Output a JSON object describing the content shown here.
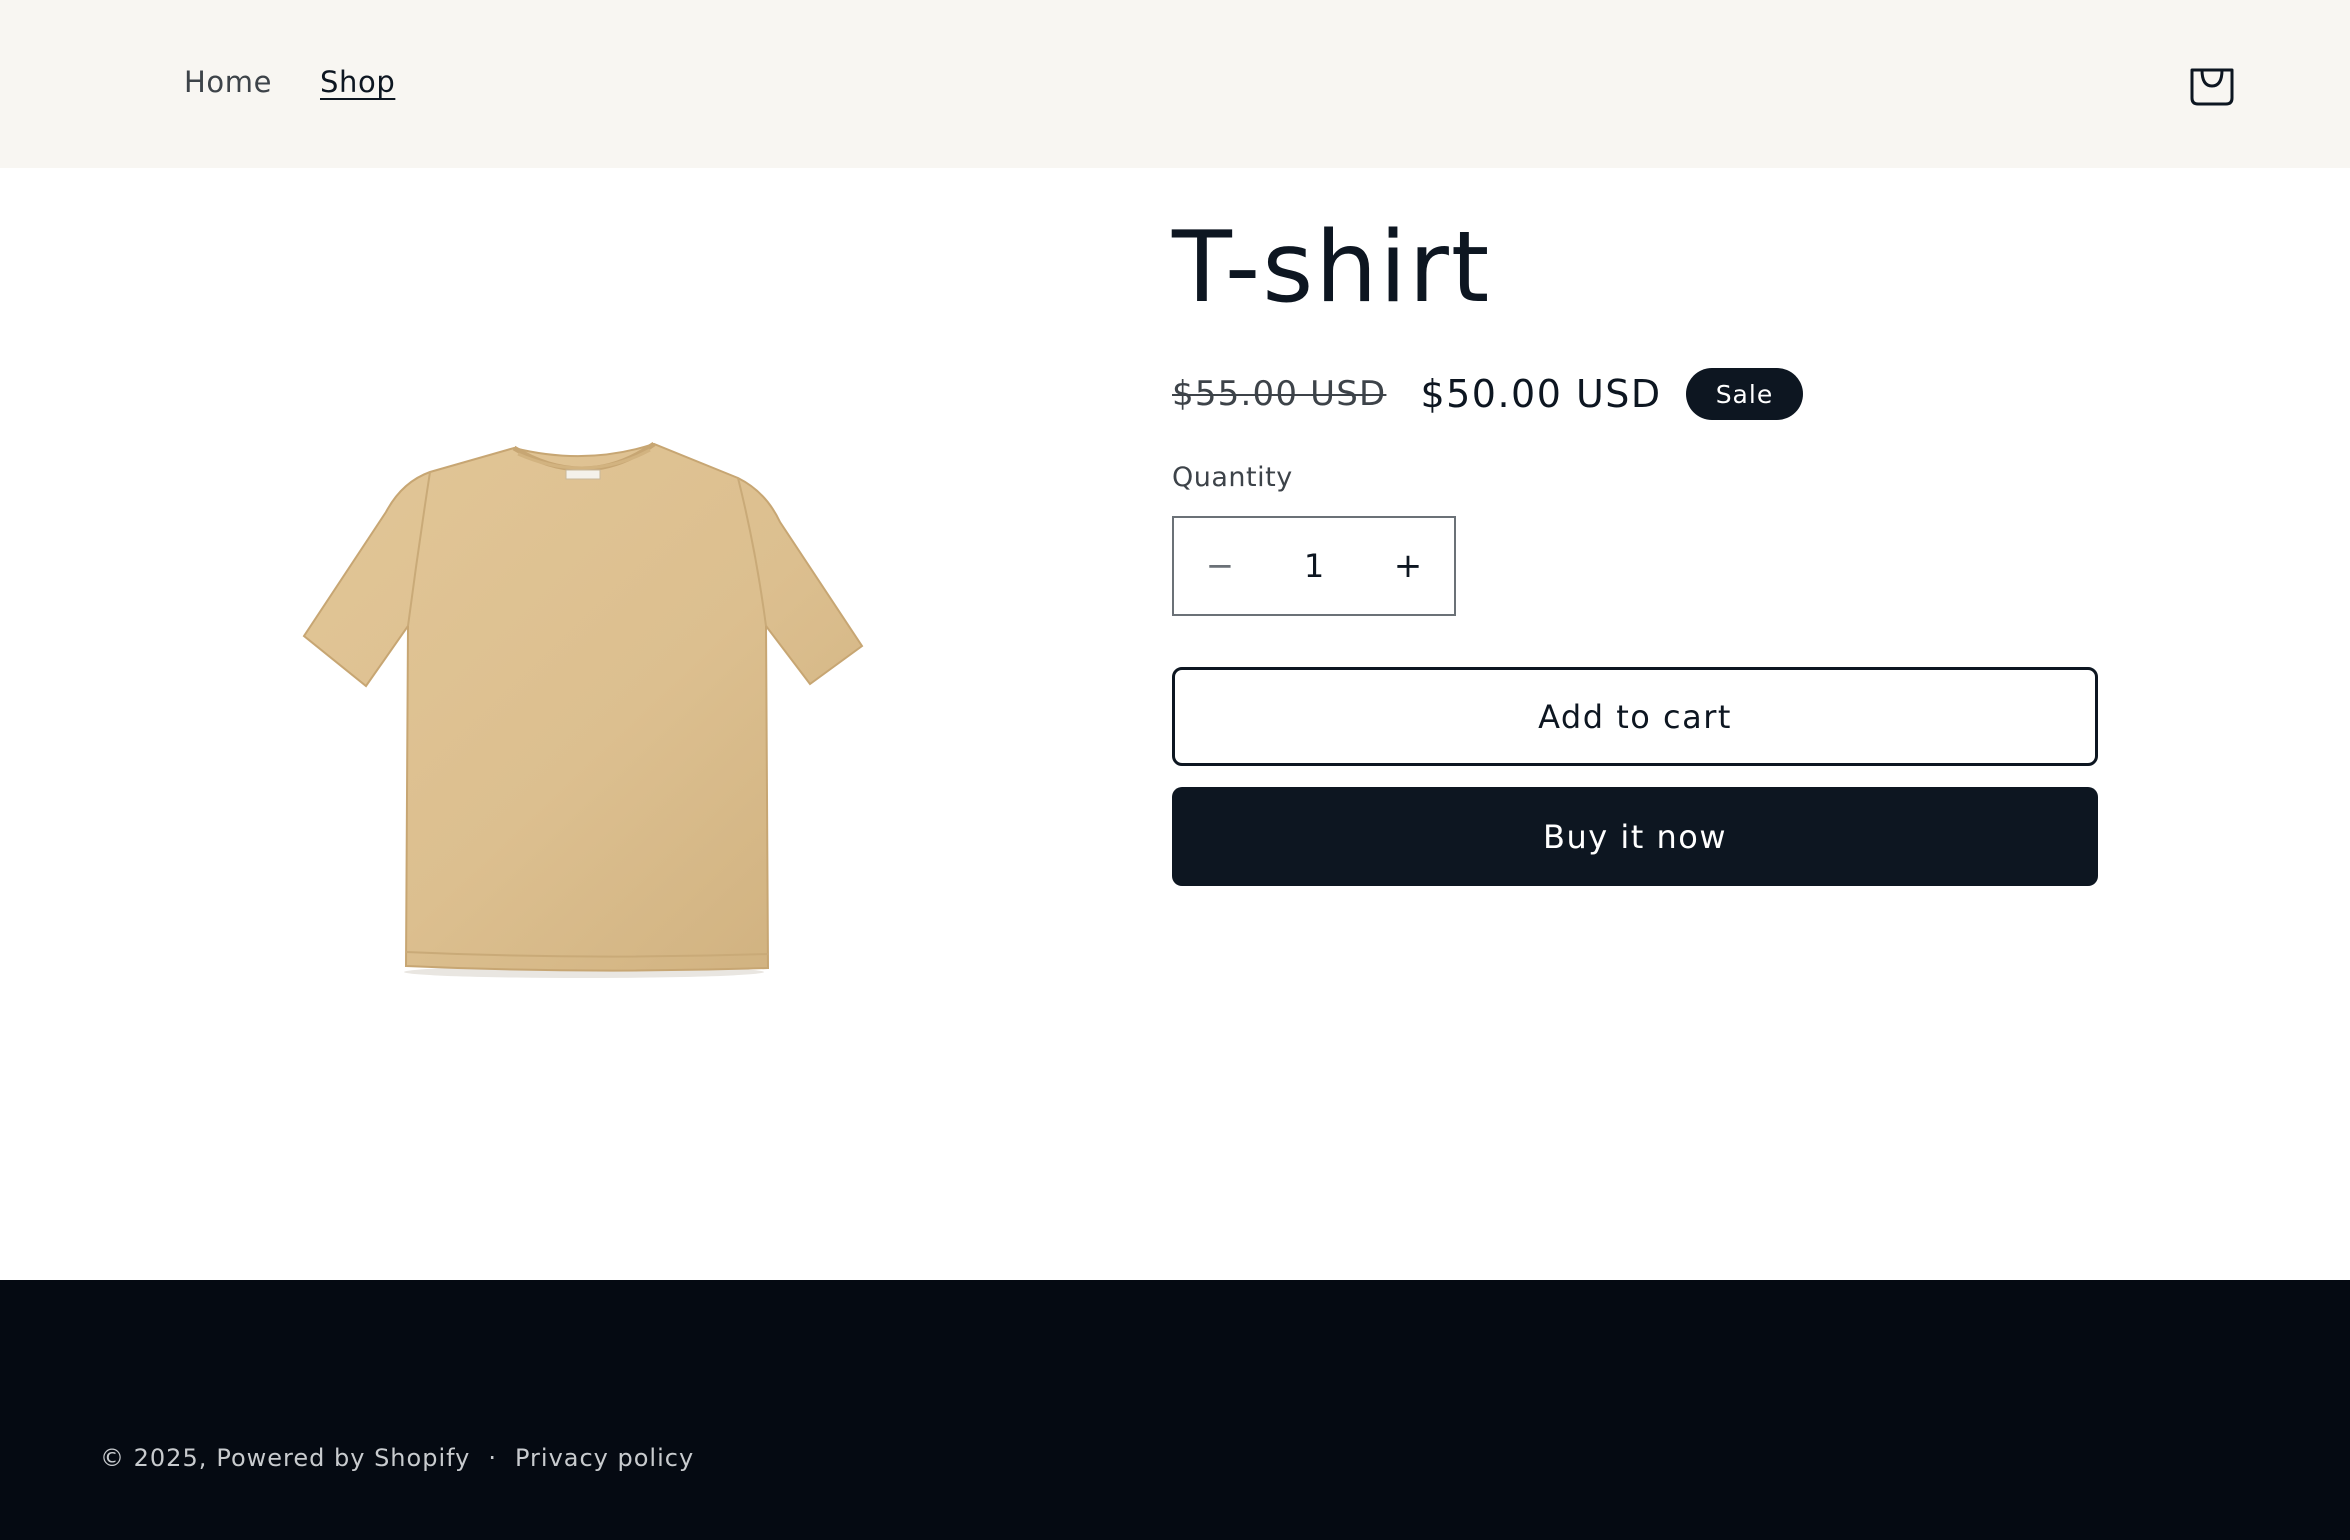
{
  "header": {
    "nav": [
      {
        "label": "Home",
        "active": false
      },
      {
        "label": "Shop",
        "active": true
      }
    ],
    "cart_icon": "shopping-bag-icon"
  },
  "product": {
    "image_alt": "T-shirt",
    "title": "T-shirt",
    "price_compare": "$55.00 USD",
    "price_sale": "$50.00 USD",
    "badge": "Sale",
    "quantity_label": "Quantity",
    "quantity_value": "1",
    "minus_symbol": "−",
    "plus_symbol": "+",
    "add_to_cart_label": "Add to cart",
    "buy_now_label": "Buy it now"
  },
  "footer": {
    "copyright": "© 2025,",
    "powered_by": "Powered by Shopify",
    "separator": "·",
    "privacy_link": "Privacy policy"
  },
  "colors": {
    "header_bg": "#f8f6f2",
    "primary": "#0d1621",
    "footer_bg": "#050a12",
    "tshirt": "#dcbf8f"
  }
}
